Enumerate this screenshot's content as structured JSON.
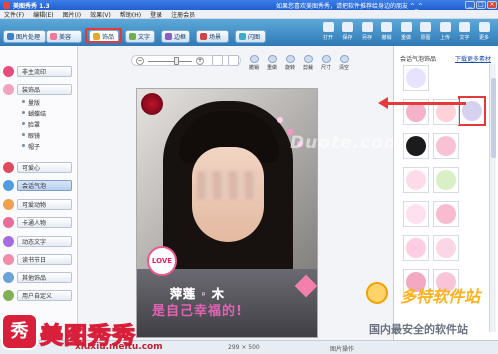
{
  "window": {
    "title": "美图秀秀 1.3",
    "tip": "如果您喜欢美图秀秀，请把软件推荐给身边的朋友 ^_^"
  },
  "window_buttons": [
    "_",
    "□",
    "×"
  ],
  "menu": [
    "文件(F)",
    "编辑(E)",
    "图片(I)",
    "效果(V)",
    "帮助(H)",
    "登录",
    "注册会员"
  ],
  "tabs": [
    {
      "label": "图片处理",
      "color": "#3f7fd0"
    },
    {
      "label": "美容",
      "color": "#f07a9a"
    },
    {
      "label": "饰品",
      "color": "#e5a92d"
    },
    {
      "label": "文字",
      "color": "#6fb04b"
    },
    {
      "label": "边框",
      "color": "#8d5bc2"
    },
    {
      "label": "场景",
      "color": "#d04444"
    },
    {
      "label": "闪图",
      "color": "#3fa9c9"
    }
  ],
  "toolbar": [
    "打开",
    "保存",
    "另存",
    "撤销",
    "重做",
    "原图",
    "上传",
    "文字",
    "更多"
  ],
  "left_panel": {
    "items": [
      {
        "label": "非主流印",
        "icon_color": "#e74c7c",
        "selected": false
      },
      {
        "label": "装饰品",
        "icon_color": "#f2a3be",
        "selected": false
      },
      {
        "label": "可爱心",
        "icon_color": "#e04a5f",
        "selected": false
      },
      {
        "label": "会话气泡",
        "icon_color": "#4f9de0",
        "selected": true
      },
      {
        "label": "可爱动物",
        "icon_color": "#f0a14d",
        "selected": false
      },
      {
        "label": "卡通人物",
        "icon_color": "#e86f9b",
        "selected": false
      },
      {
        "label": "动态文字",
        "icon_color": "#a66de2",
        "selected": false
      },
      {
        "label": "读书节日",
        "icon_color": "#f18da7",
        "selected": false
      },
      {
        "label": "其他饰品",
        "icon_color": "#6aa3d8",
        "selected": false
      },
      {
        "label": "用户自定义",
        "icon_color": "#7fb253",
        "selected": false
      }
    ],
    "subitems": [
      "量版",
      "蝴蝶结",
      "脸罩",
      "眼镜",
      "帽子"
    ]
  },
  "edit_tools": [
    "撤销",
    "重做",
    "旋转",
    "剪裁",
    "尺寸",
    "清空"
  ],
  "photo": {
    "sticker_love": "LOVE",
    "caption1": "萍莲 ·  木",
    "caption2": "是自己幸福的!",
    "watermark": "Duote.com"
  },
  "right_panel": {
    "title": "会话气泡饰品",
    "link": "下载更多素材",
    "thumbs": [
      {
        "color": "#e7e2ff"
      },
      {
        "color": "#d6d1ef"
      },
      {
        "color": "#f4b1ca"
      },
      {
        "color": "#ffd1d8"
      },
      {
        "color": "#1b1b1b"
      },
      {
        "color": "#f7c2d4"
      },
      {
        "color": "#ffdbe9"
      },
      {
        "color": "#d9f0c6"
      },
      {
        "color": "#ffe0f0"
      },
      {
        "color": "#f9bbd0"
      },
      {
        "color": "#ffcde3"
      },
      {
        "color": "#fbd6e6"
      },
      {
        "color": "#f3a9c2"
      },
      {
        "color": "#f8c4d8"
      }
    ]
  },
  "statusbar": {
    "size": "299 × 500",
    "mode": "图片操作"
  },
  "branding": {
    "logo": "秀",
    "name": "美图秀秀",
    "url": "xiuxiu.meitu.com"
  },
  "watermark2": {
    "text": "多特软件站",
    "sub": "国内最安全的软件站"
  }
}
